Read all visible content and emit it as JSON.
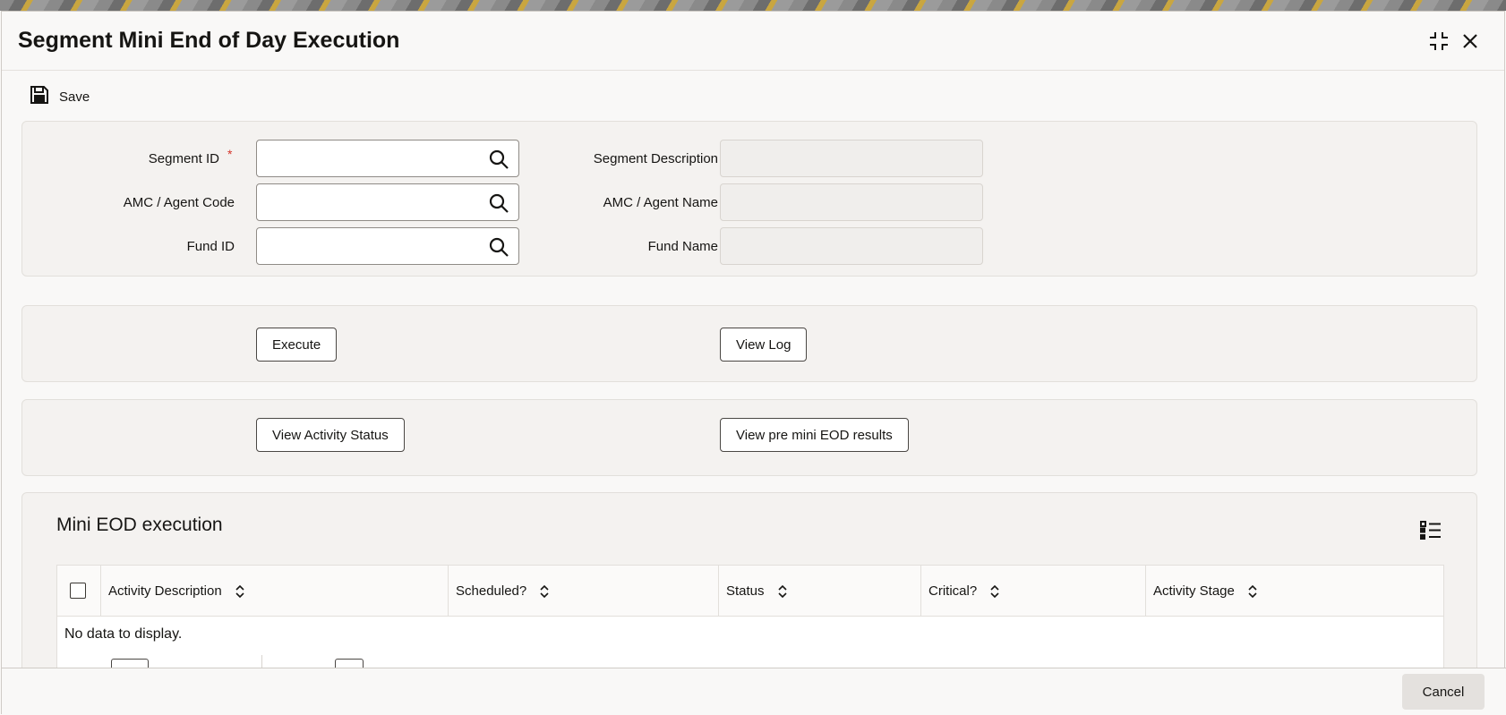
{
  "dialog": {
    "title": "Segment Mini End of Day Execution"
  },
  "toolbar": {
    "save_label": "Save"
  },
  "form": {
    "segment_id_label": "Segment ID",
    "segment_id_required": "*",
    "segment_id_value": "",
    "agent_code_label": "AMC / Agent Code",
    "agent_code_value": "",
    "fund_id_label": "Fund ID",
    "fund_id_value": "",
    "segment_desc_label": "Segment Description",
    "agent_name_label": "AMC / Agent Name",
    "fund_name_label": "Fund Name"
  },
  "actions": {
    "execute_label": "Execute",
    "view_log_label": "View Log",
    "view_activity_status_label": "View Activity Status",
    "view_pre_eod_label": "View pre mini EOD results"
  },
  "grid": {
    "section_title": "Mini EOD execution",
    "columns": [
      "Activity Description",
      "Scheduled?",
      "Status",
      "Critical?",
      "Activity Stage"
    ],
    "empty_message": "No data to display."
  },
  "footer": {
    "cancel_label": "Cancel"
  },
  "colors": {
    "accent": "#161513",
    "required": "#d4352a",
    "panel": "#f4f2f0"
  },
  "icons": [
    "save-icon",
    "maximize-icon",
    "close-icon",
    "search-icon",
    "sort-icon",
    "column-list-icon"
  ]
}
